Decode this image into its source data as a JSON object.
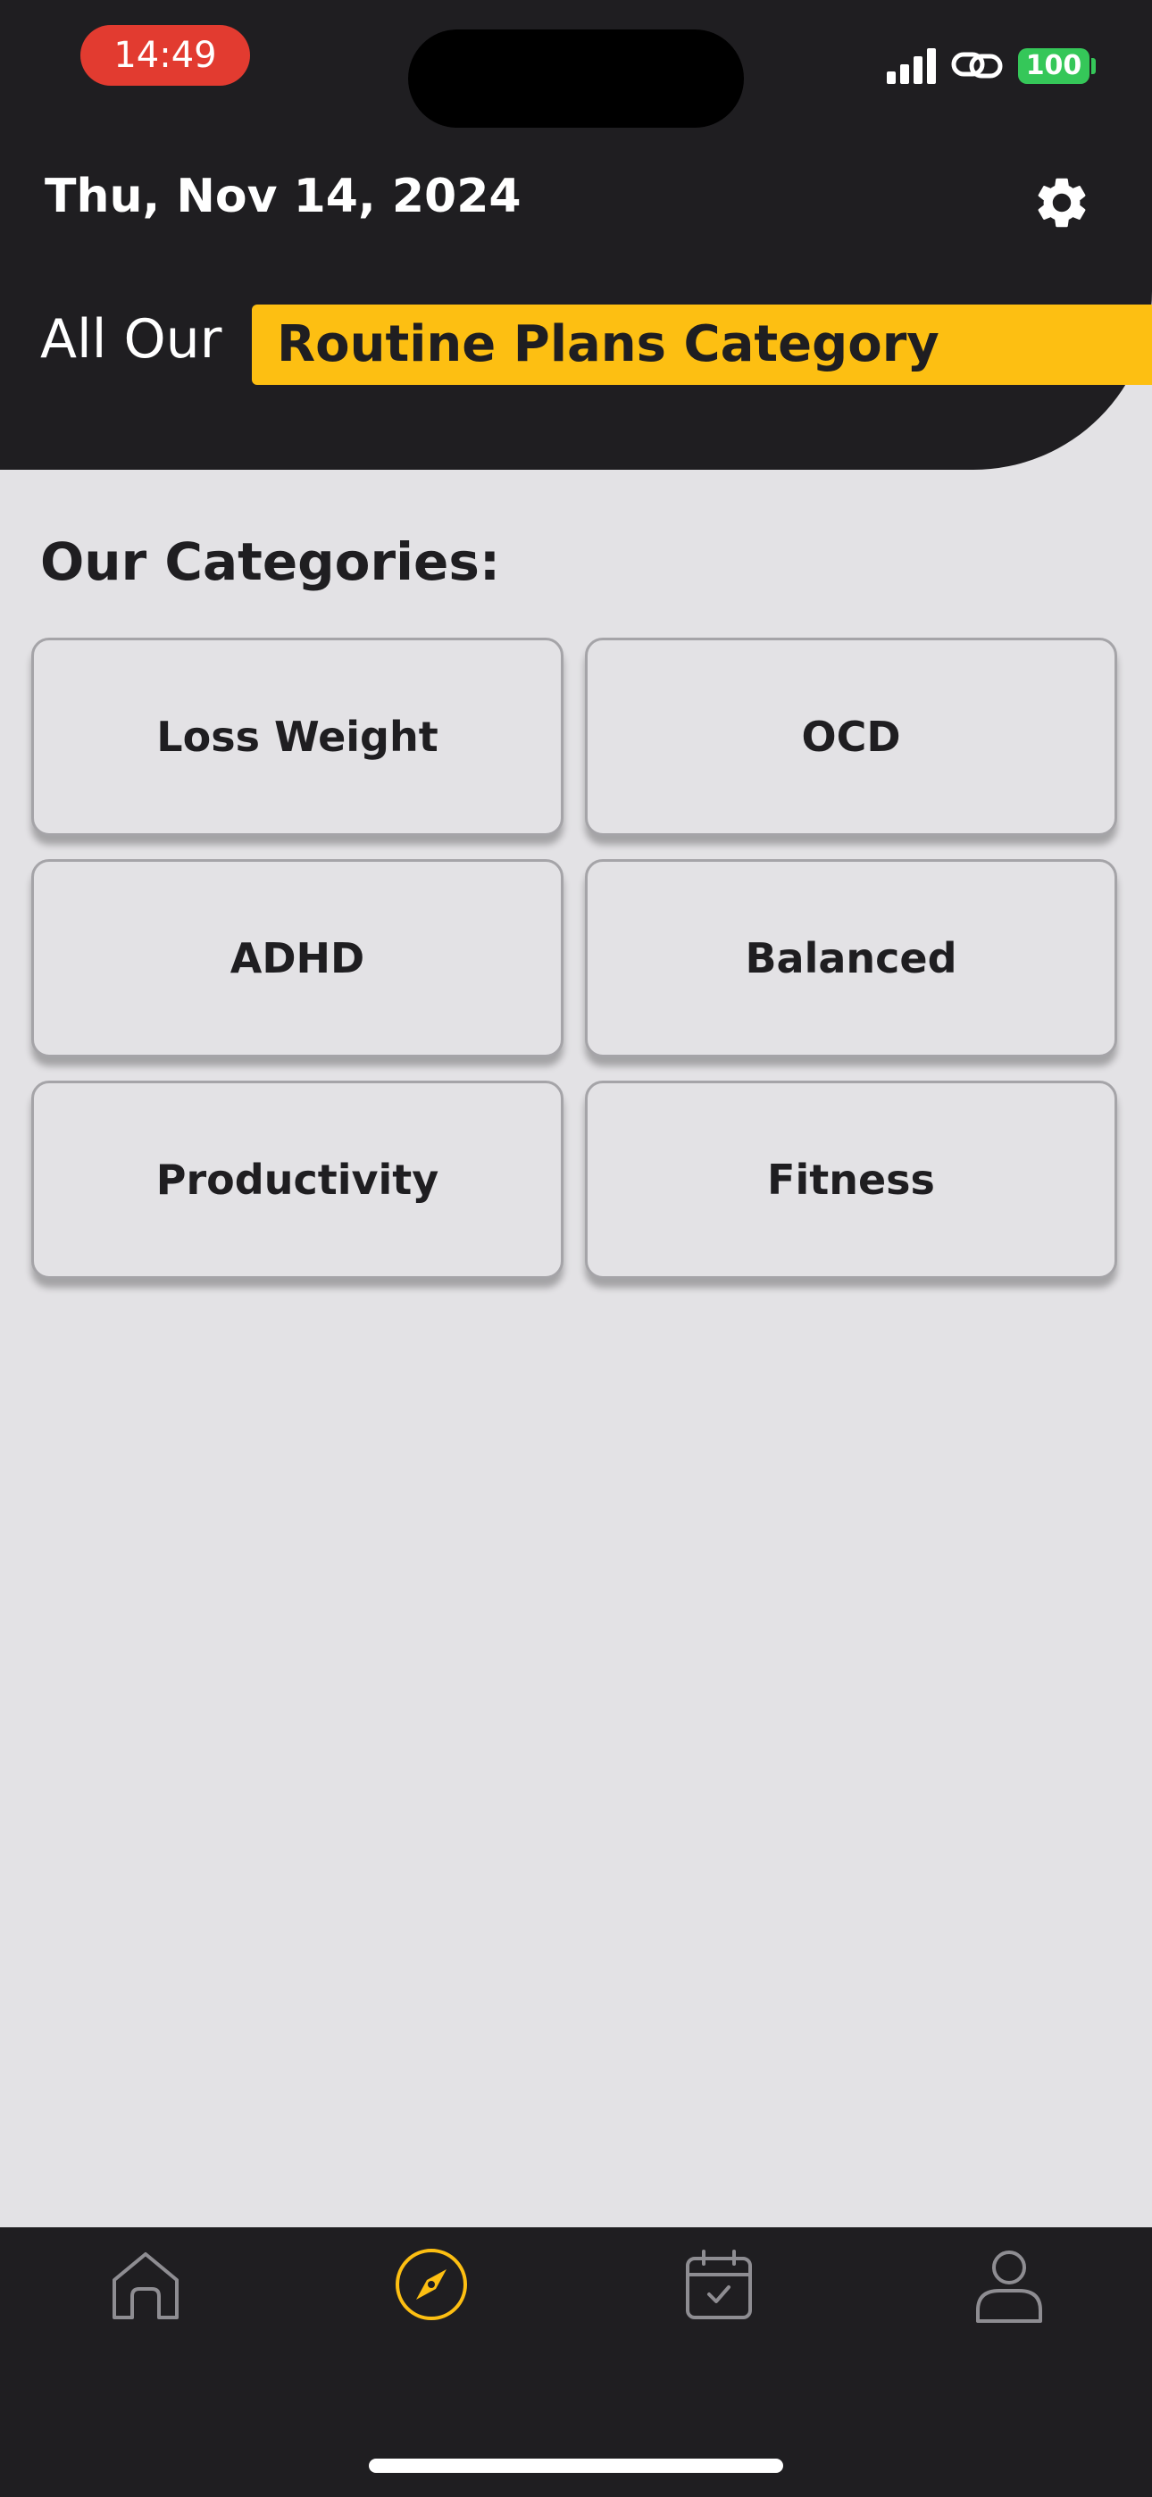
{
  "status_bar": {
    "time": "14:49",
    "battery": "100",
    "icons": [
      "signal-icon",
      "link-icon",
      "battery-icon"
    ]
  },
  "header": {
    "date": "Thu, Nov 14, 2024",
    "prefix": "All Our",
    "highlight": "Routine Plans Category",
    "icons": [
      "gear-icon"
    ]
  },
  "content": {
    "title": "Our Categories:",
    "categories": [
      {
        "label": "Loss Weight"
      },
      {
        "label": "OCD"
      },
      {
        "label": "ADHD"
      },
      {
        "label": "Balanced"
      },
      {
        "label": "Productivity"
      },
      {
        "label": "Fitness"
      }
    ]
  },
  "tab_bar": {
    "tabs": [
      {
        "icon": "home-icon",
        "active": false
      },
      {
        "icon": "compass-icon",
        "active": true
      },
      {
        "icon": "calendar-check-icon",
        "active": false
      },
      {
        "icon": "profile-icon",
        "active": false
      }
    ]
  },
  "colors": {
    "dark": "#1f1e21",
    "accent": "#fdbf12",
    "background": "#e3e2e5",
    "recording": "#e23b30",
    "battery": "#35c759",
    "inactive_icon": "#8e8d92"
  }
}
